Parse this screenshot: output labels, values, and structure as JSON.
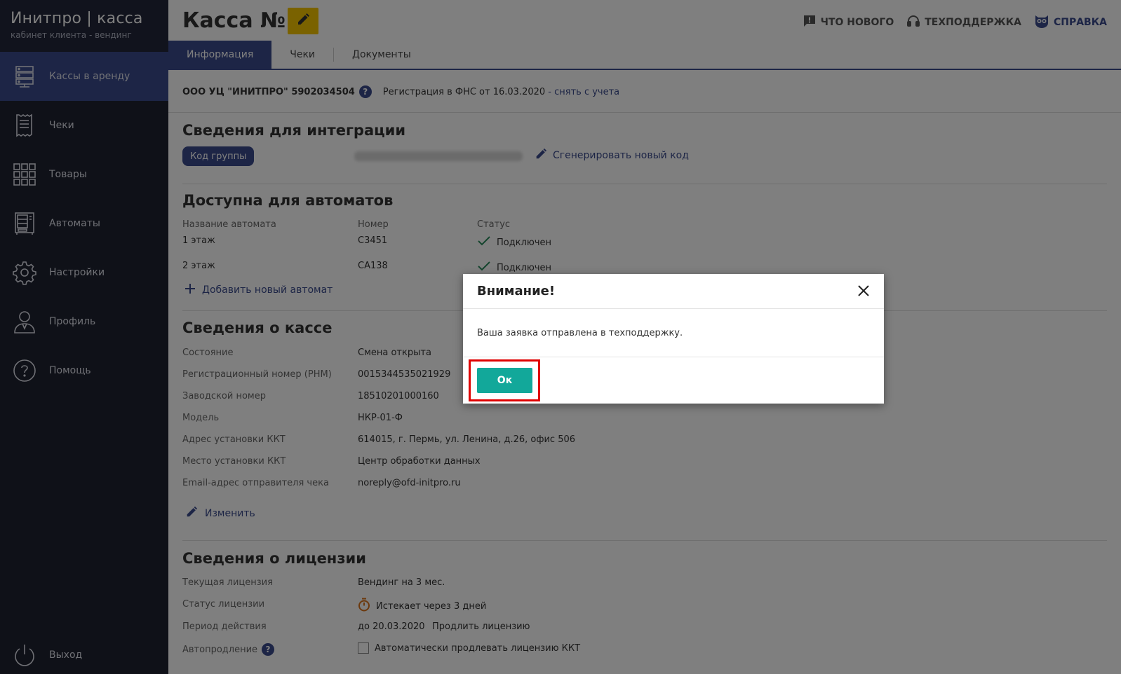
{
  "app": {
    "logo_title": "Инитпро | касса",
    "logo_subtitle": "кабинет клиента - вендинг"
  },
  "sidebar": {
    "items": [
      {
        "label": "Кассы в аренду",
        "icon": "server-rack-icon",
        "active": true
      },
      {
        "label": "Чеки",
        "icon": "receipt-icon",
        "active": false
      },
      {
        "label": "Товары",
        "icon": "grid-icon",
        "active": false
      },
      {
        "label": "Автоматы",
        "icon": "vending-machine-icon",
        "active": false
      },
      {
        "label": "Настройки",
        "icon": "gear-icon",
        "active": false
      },
      {
        "label": "Профиль",
        "icon": "user-icon",
        "active": false
      },
      {
        "label": "Помощь",
        "icon": "question-circle-icon",
        "active": false
      }
    ],
    "logout_label": "Выход"
  },
  "header": {
    "title": "Касса №1",
    "links": {
      "whats_new": "ЧТО НОВОГО",
      "support": "ТЕХПОДДЕРЖКА",
      "help": "СПРАВКА"
    }
  },
  "tabs": [
    "Информация",
    "Чеки",
    "Документы"
  ],
  "registration": {
    "org": "ООО УЦ \"ИНИТПРО\" 5902034504",
    "text": "Регистрация в ФНС от 16.03.2020",
    "deregister_link": "- снять с учета"
  },
  "integration": {
    "title": "Сведения для интеграции",
    "group_code_label": "Код группы",
    "generate_link": "Сгенерировать новый код"
  },
  "machines": {
    "title": "Доступна для автоматов",
    "columns": [
      "Название автомата",
      "Номер",
      "Статус"
    ],
    "rows": [
      {
        "name": "1 этаж",
        "number": "C3451",
        "status": "Подключен"
      },
      {
        "name": "2 этаж",
        "number": "CA138",
        "status": "Подключен"
      }
    ],
    "add_link": "Добавить новый автомат"
  },
  "kassa": {
    "title": "Сведения о кассе",
    "fields": [
      {
        "label": "Состояние",
        "value": "Смена открыта"
      },
      {
        "label": "Регистрационный номер (РНМ)",
        "value": "0015344535021929"
      },
      {
        "label": "Заводской номер",
        "value": "18510201000160"
      },
      {
        "label": "Модель",
        "value": "НКР-01-Ф"
      },
      {
        "label": "Адрес установки ККТ",
        "value": "614015, г. Пермь, ул. Ленина, д.26, офис 506"
      },
      {
        "label": "Место установки ККТ",
        "value": "Центр обработки данных"
      },
      {
        "label": "Email-адрес отправителя чека",
        "value": "noreply@ofd-initpro.ru"
      }
    ],
    "edit_link": "Изменить"
  },
  "license": {
    "title": "Сведения о лицензии",
    "current_label": "Текущая лицензия",
    "current_value": "Вендинг на 3 мес.",
    "status_label": "Статус лицензии",
    "status_value": "Истекает через 3 дней",
    "period_label": "Период действия",
    "period_value": "до 20.03.2020",
    "extend_link": "Продлить лицензию",
    "autorenew_label": "Автопродление",
    "autorenew_checkbox_label": "Автоматически продлевать лицензию ККТ",
    "autorenew_checked": false
  },
  "modal": {
    "title": "Внимание!",
    "message": "Ваша заявка отправлена в техподдержку.",
    "ok_label": "Ок"
  },
  "colors": {
    "sidebar_bg": "#1f2230",
    "accent": "#3a4a8c",
    "edit_button": "#f5c400",
    "ok_button": "#12a89a",
    "highlight": "#e00000"
  }
}
